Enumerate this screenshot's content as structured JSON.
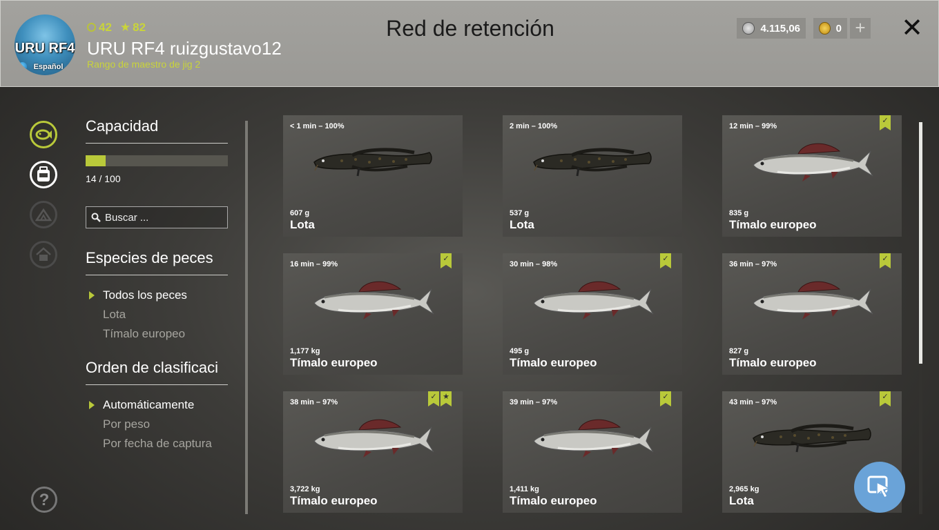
{
  "header": {
    "title": "Red de retención",
    "player": {
      "avatar_text": "URU RF4",
      "avatar_sub": "Español",
      "level": "42",
      "stars": "82",
      "name": "URU RF4 ruizgustavo12",
      "rank": "Rango de maestro de jig 2"
    },
    "currency": {
      "silver": "4.115,06",
      "gold": "0"
    },
    "plus_label": "+",
    "close_label": "✕"
  },
  "nav": [
    {
      "name": "keepnet-icon",
      "state": "active"
    },
    {
      "name": "cooler-icon",
      "state": "selected"
    },
    {
      "name": "camp-icon",
      "state": "dim"
    },
    {
      "name": "home-icon",
      "state": "dim"
    }
  ],
  "help_label": "?",
  "sidebar": {
    "capacity_title": "Capacidad",
    "capacity_text": "14 / 100",
    "capacity_fraction": 0.14,
    "search_placeholder": "Buscar ...",
    "species_title": "Especies de peces",
    "species": [
      {
        "label": "Todos los peces",
        "active": true
      },
      {
        "label": "Lota",
        "active": false
      },
      {
        "label": "Tímalo europeo",
        "active": false
      }
    ],
    "sort_title": "Orden de clasificaci",
    "sort": [
      {
        "label": "Automáticamente",
        "active": true
      },
      {
        "label": "Por peso",
        "active": false
      },
      {
        "label": "Por fecha de captura",
        "active": false
      }
    ]
  },
  "fish": [
    {
      "time": "< 1 min – 100%",
      "weight": "607 g",
      "name": "Lota",
      "type": "burbot",
      "marks": []
    },
    {
      "time": "2 min – 100%",
      "weight": "537 g",
      "name": "Lota",
      "type": "burbot",
      "marks": []
    },
    {
      "time": "12 min – 99%",
      "weight": "835 g",
      "name": "Tímalo europeo",
      "type": "grayling",
      "marks": [
        "check"
      ]
    },
    {
      "time": "16 min – 99%",
      "weight": "1,177 kg",
      "name": "Tímalo europeo",
      "type": "grayling",
      "marks": [
        "check"
      ]
    },
    {
      "time": "30 min – 98%",
      "weight": "495 g",
      "name": "Tímalo europeo",
      "type": "grayling",
      "marks": [
        "check"
      ]
    },
    {
      "time": "36 min – 97%",
      "weight": "827 g",
      "name": "Tímalo europeo",
      "type": "grayling",
      "marks": [
        "check"
      ]
    },
    {
      "time": "38 min – 97%",
      "weight": "3,722 kg",
      "name": "Tímalo europeo",
      "type": "grayling",
      "marks": [
        "check",
        "star"
      ]
    },
    {
      "time": "39 min – 97%",
      "weight": "1,411 kg",
      "name": "Tímalo europeo",
      "type": "grayling",
      "marks": [
        "check"
      ]
    },
    {
      "time": "43 min – 97%",
      "weight": "2,965 kg",
      "name": "Lota",
      "type": "burbot",
      "marks": [
        "check"
      ]
    }
  ],
  "colors": {
    "accent": "#b9c93a",
    "fab": "#6aa3d8"
  }
}
